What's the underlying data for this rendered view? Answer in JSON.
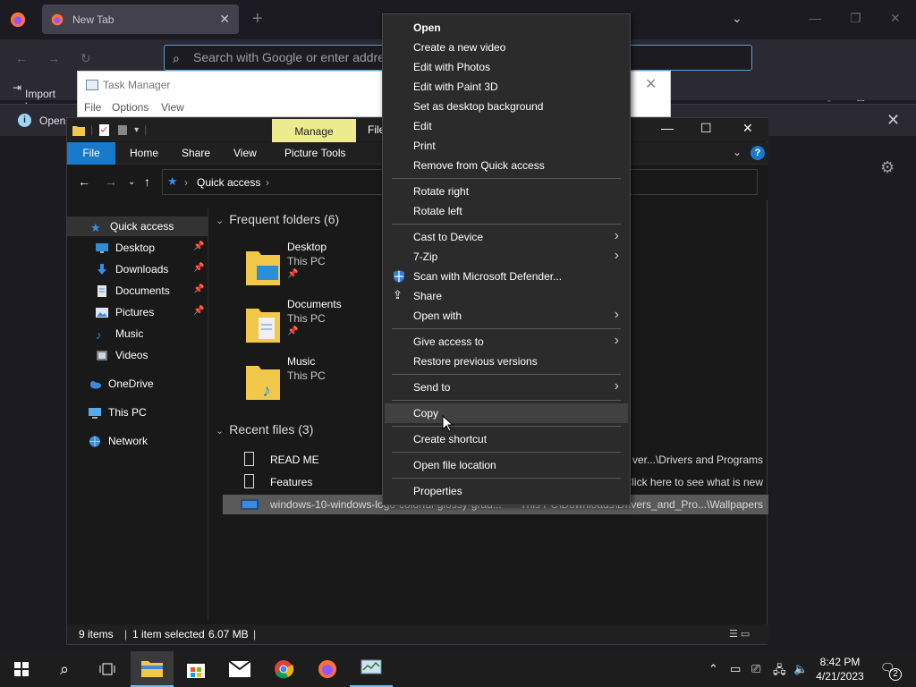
{
  "browser": {
    "tab_title": "New Tab",
    "tab_close": "✕",
    "new_tab": "+",
    "url_placeholder": "Search with Google or enter addre",
    "bookmark_import": "Import bo",
    "notice_text": "Open",
    "list_tabs": "⌄"
  },
  "task_manager": {
    "title": "Task Manager",
    "menu": [
      "File",
      "Options",
      "View"
    ]
  },
  "explorer": {
    "ribbon": {
      "manage": "Manage",
      "file_partial": "File",
      "tabs": [
        "File",
        "Home",
        "Share",
        "View",
        "Picture Tools"
      ]
    },
    "breadcrumb": "Quick access",
    "nav": {
      "quick_access": "Quick access",
      "pinned": [
        "Desktop",
        "Downloads",
        "Documents",
        "Pictures"
      ],
      "unpinned": [
        "Music",
        "Videos"
      ],
      "onedrive": "OneDrive",
      "this_pc": "This PC",
      "network": "Network"
    },
    "frequent_header": "Frequent folders (6)",
    "frequent": [
      {
        "name": "Desktop",
        "location": "This PC"
      },
      {
        "name": "Documents",
        "location": "This PC"
      },
      {
        "name": "Music",
        "location": "This PC"
      }
    ],
    "recent_header": "Recent files (3)",
    "recent": [
      {
        "name": "READ ME",
        "path": "ver...\\Drivers and Programs"
      },
      {
        "name": "Features",
        "path": "Click here to see what is new"
      },
      {
        "name": "windows-10-windows-logo-colorful-glossy-grad...",
        "path": "This PC\\Downloads\\Drivers_and_Pro...\\Wallpapers"
      }
    ],
    "status": {
      "items": "9 items",
      "selected": "1 item selected",
      "size": "6.07 MB"
    }
  },
  "context_menu": {
    "groups": [
      [
        {
          "label": "Open",
          "bold": true
        },
        {
          "label": "Create a new video"
        },
        {
          "label": "Edit with Photos"
        },
        {
          "label": "Edit with Paint 3D"
        },
        {
          "label": "Set as desktop background"
        },
        {
          "label": "Edit"
        },
        {
          "label": "Print"
        },
        {
          "label": "Remove from Quick access"
        }
      ],
      [
        {
          "label": "Rotate right"
        },
        {
          "label": "Rotate left"
        }
      ],
      [
        {
          "label": "Cast to Device",
          "submenu": true
        },
        {
          "label": "7-Zip",
          "submenu": true
        },
        {
          "label": "Scan with Microsoft Defender...",
          "icon": "defender-shield-icon"
        },
        {
          "label": "Share",
          "icon": "share-icon"
        },
        {
          "label": "Open with",
          "submenu": true
        }
      ],
      [
        {
          "label": "Give access to",
          "submenu": true
        },
        {
          "label": "Restore previous versions"
        }
      ],
      [
        {
          "label": "Send to",
          "submenu": true
        }
      ],
      [
        {
          "label": "Copy",
          "hover": true
        }
      ],
      [
        {
          "label": "Create shortcut"
        }
      ],
      [
        {
          "label": "Open file location"
        }
      ],
      [
        {
          "label": "Properties"
        }
      ]
    ]
  },
  "taskbar": {
    "time": "8:42 PM",
    "date": "4/21/2023",
    "notification_count": "2",
    "pinned_apps": [
      "windows-start-icon",
      "search-icon",
      "task-view-icon",
      "file-explorer-icon",
      "microsoft-store-icon",
      "mail-icon",
      "chrome-icon",
      "firefox-icon",
      "task-manager-icon"
    ]
  },
  "colors": {
    "accent": "#1979ca",
    "manage_tab": "#ecec8f",
    "folder": "#f2c84b"
  }
}
